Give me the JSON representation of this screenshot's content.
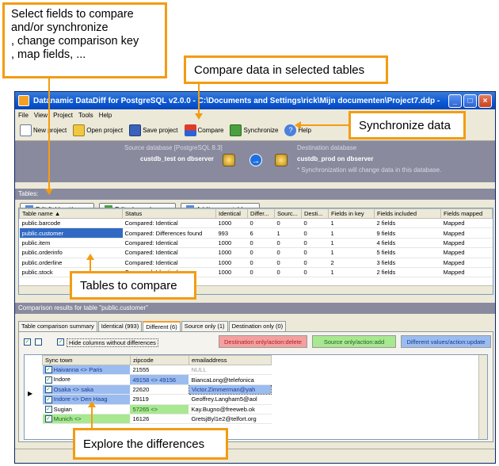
{
  "callouts": {
    "select_fields": {
      "line1": "Select fields to compare",
      "line2": "and/or synchronize",
      "line3": ", change comparison key",
      "line4": ", map fields, ..."
    },
    "compare_data": "Compare data in selected tables",
    "synchronize_data": "Synchronize data",
    "tables_to_compare": "Tables to compare",
    "explore": "Explore the differences"
  },
  "window": {
    "title": "Datanamic DataDiff for PostgreSQL v2.0.0 - C:\\Documents and Settings\\rick\\Mijn documenten\\Project7.ddp -"
  },
  "menu": [
    "File",
    "View",
    "Project",
    "Tools",
    "Help"
  ],
  "toolbar": {
    "new_project": "New project",
    "open_project": "Open project",
    "save_project": "Save project",
    "compare": "Compare",
    "synchronize": "Synchronize",
    "help": "Help"
  },
  "source": {
    "label": "Source database [PostgreSQL 8.3]",
    "value": "custdb_test on dbserver"
  },
  "destination": {
    "label": "Destination database",
    "value": "custdb_prod on dbserver",
    "note": "* Synchronization will change data in this database."
  },
  "tables_section": "Tables:",
  "table_buttons": {
    "edit_field": "Edit field settings...",
    "edit_where": "Edit where clause...",
    "add_remove": "Add/remove tables..."
  },
  "tables": {
    "headers": [
      "Table name",
      "Status",
      "Identical",
      "Differ...",
      "Sourc...",
      "Desti...",
      "Fields in key",
      "Fields included",
      "Fields mapped"
    ],
    "rows": [
      [
        "public.barcode",
        "Compared: Identical",
        "1000",
        "0",
        "0",
        "0",
        "1",
        "2 fields",
        "Mapped"
      ],
      [
        "public.customer",
        "Compared: Differences found",
        "993",
        "6",
        "1",
        "0",
        "1",
        "9 fields",
        "Mapped"
      ],
      [
        "public.item",
        "Compared: Identical",
        "1000",
        "0",
        "0",
        "0",
        "1",
        "4 fields",
        "Mapped"
      ],
      [
        "public.orderinfo",
        "Compared: Identical",
        "1000",
        "0",
        "0",
        "0",
        "1",
        "5 fields",
        "Mapped"
      ],
      [
        "public.orderline",
        "Compared: Identical",
        "1000",
        "0",
        "0",
        "0",
        "2",
        "3 fields",
        "Mapped"
      ],
      [
        "public.stock",
        "Compared: Identical",
        "1000",
        "0",
        "0",
        "0",
        "1",
        "2 fields",
        "Mapped"
      ]
    ]
  },
  "results_section": "Comparison results for table \"public.customer\"",
  "result_tabs": [
    "Table comparison summary",
    "Identical (993)",
    "Different (6)",
    "Source only (1)",
    "Destination only (0)"
  ],
  "hide_columns_label": "Hide columns without differences",
  "legend": {
    "dest_only": "Destination only/action:delete",
    "source_only": "Source only/action:add",
    "different": "Different values/action:update"
  },
  "diff": {
    "headers": [
      "Sync town",
      "zipcode",
      "emailaddress"
    ],
    "rows": [
      [
        "Haivanna <> Paris",
        "21555",
        "NULL"
      ],
      [
        "Indore",
        "49158 <> 49156",
        "BiancaLong@telefonica"
      ],
      [
        "Osaka <> saka",
        "22620",
        "Victor.Zimmerman@yah"
      ],
      [
        "Indore <> Den Haag",
        "29119",
        "Geoffrey.Langham5@aol"
      ],
      [
        "Sugian",
        "57265 <>",
        "Kay.Bugno@freeweb.ok"
      ],
      [
        "Munich <>",
        "16126",
        "GretsjByl1e2@telfort.org"
      ]
    ]
  },
  "colors": {
    "accent": "#f39c12",
    "legend_delete": "#f4a0a0",
    "legend_add": "#a8e890",
    "legend_update": "#9bbcef",
    "selection": "#316ac5"
  }
}
